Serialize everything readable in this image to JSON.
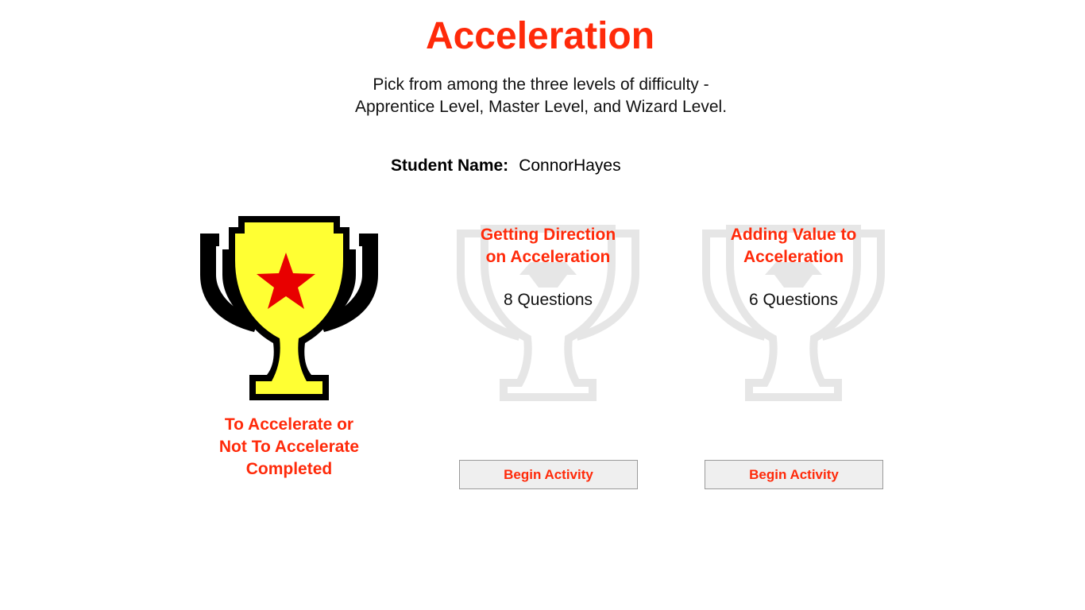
{
  "page": {
    "title": "Acceleration",
    "subtitle_line1": "Pick from among the three levels of difficulty -",
    "subtitle_line2": "Apprentice Level, Master Level, and Wizard Level."
  },
  "student": {
    "label": "Student Name:",
    "name": "ConnorHayes"
  },
  "activities": [
    {
      "status": "completed",
      "title_line1": "To Accelerate or",
      "title_line2": "Not To Accelerate",
      "status_text": "Completed",
      "icon": "gold-trophy-star-icon"
    },
    {
      "status": "available",
      "title_line1": "Getting Direction",
      "title_line2": "on Acceleration",
      "questions": "8 Questions",
      "button_label": "Begin Activity",
      "icon": "grey-trophy-icon"
    },
    {
      "status": "available",
      "title_line1": "Adding Value to",
      "title_line2": "Acceleration",
      "questions": "6 Questions",
      "button_label": "Begin Activity",
      "icon": "grey-trophy-icon"
    }
  ],
  "colors": {
    "accent": "#ff2a0a",
    "trophy_gold": "#ffff33",
    "trophy_star": "#e80000",
    "trophy_faded": "#e6e6e6",
    "button_bg": "#efefef"
  }
}
